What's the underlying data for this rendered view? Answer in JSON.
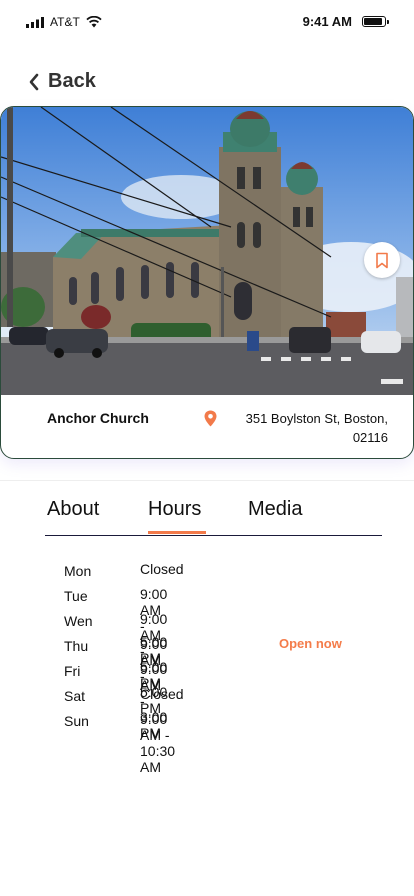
{
  "status_bar": {
    "carrier": "AT&T",
    "time": "9:41 AM"
  },
  "nav": {
    "back_label": "Back"
  },
  "place": {
    "name": "Anchor Church",
    "address_line1": "351 Boylston St, Boston,",
    "address_line2": "02116"
  },
  "tabs": [
    {
      "label": "About",
      "active": false
    },
    {
      "label": "Hours",
      "active": true
    },
    {
      "label": "Media",
      "active": false
    }
  ],
  "hours": [
    {
      "day": "Mon",
      "time": "Closed"
    },
    {
      "day": "Tue",
      "time": "9:00 AM - 5:00 PM"
    },
    {
      "day": "Wen",
      "time": "9:00 AM - 5:00 PM"
    },
    {
      "day": "Thu",
      "time": "9:00 AM - 5:00 PM",
      "badge": "Open now"
    },
    {
      "day": "Fri",
      "time": "9:00 AM - 3:00 PM"
    },
    {
      "day": "Sat",
      "time": "Closed"
    },
    {
      "day": "Sun",
      "time": "9:00 AM - 10:30 AM"
    }
  ],
  "colors": {
    "accent": "#f27a4a",
    "card_border": "#2b4b3b"
  },
  "icons": [
    "signal-icon",
    "wifi-icon",
    "battery-icon",
    "chevron-left-icon",
    "bookmark-icon",
    "location-pin-icon"
  ]
}
